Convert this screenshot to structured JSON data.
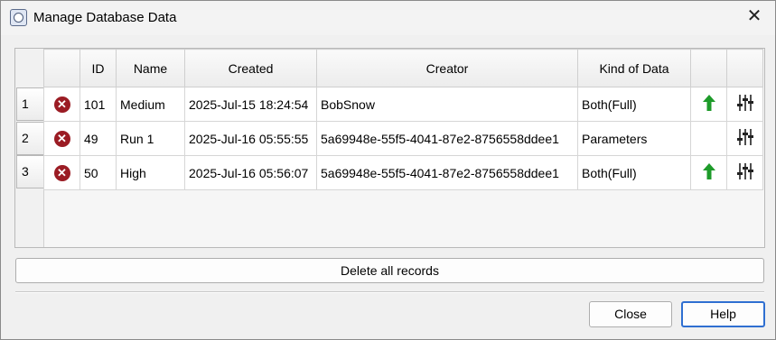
{
  "window": {
    "title": "Manage Database Data"
  },
  "table": {
    "columns": [
      "",
      "ID",
      "Name",
      "Created",
      "Creator",
      "Kind of Data",
      "",
      ""
    ],
    "rows": [
      {
        "num": "1",
        "id": "101",
        "name": "Medium",
        "created": "2025-Jul-15 18:24:54",
        "creator": "BobSnow",
        "kind": "Both(Full)",
        "upload": true
      },
      {
        "num": "2",
        "id": "49",
        "name": "Run 1",
        "created": "2025-Jul-16 05:55:55",
        "creator": "5a69948e-55f5-4041-87e2-8756558ddee1",
        "kind": "Parameters",
        "upload": false
      },
      {
        "num": "3",
        "id": "50",
        "name": "High",
        "created": "2025-Jul-16 05:56:07",
        "creator": "5a69948e-55f5-4041-87e2-8756558ddee1",
        "kind": "Both(Full)",
        "upload": true
      }
    ]
  },
  "buttons": {
    "delete_all": "Delete all records",
    "close": "Close",
    "help": "Help"
  },
  "icons": {
    "delete": "delete-record-icon",
    "upload": "upload-arrow-icon",
    "tools": "settings-sliders-icon"
  },
  "colors": {
    "delete": "#9b1c24",
    "upload": "#1e9b2a",
    "help_border": "#2f6fd1"
  }
}
